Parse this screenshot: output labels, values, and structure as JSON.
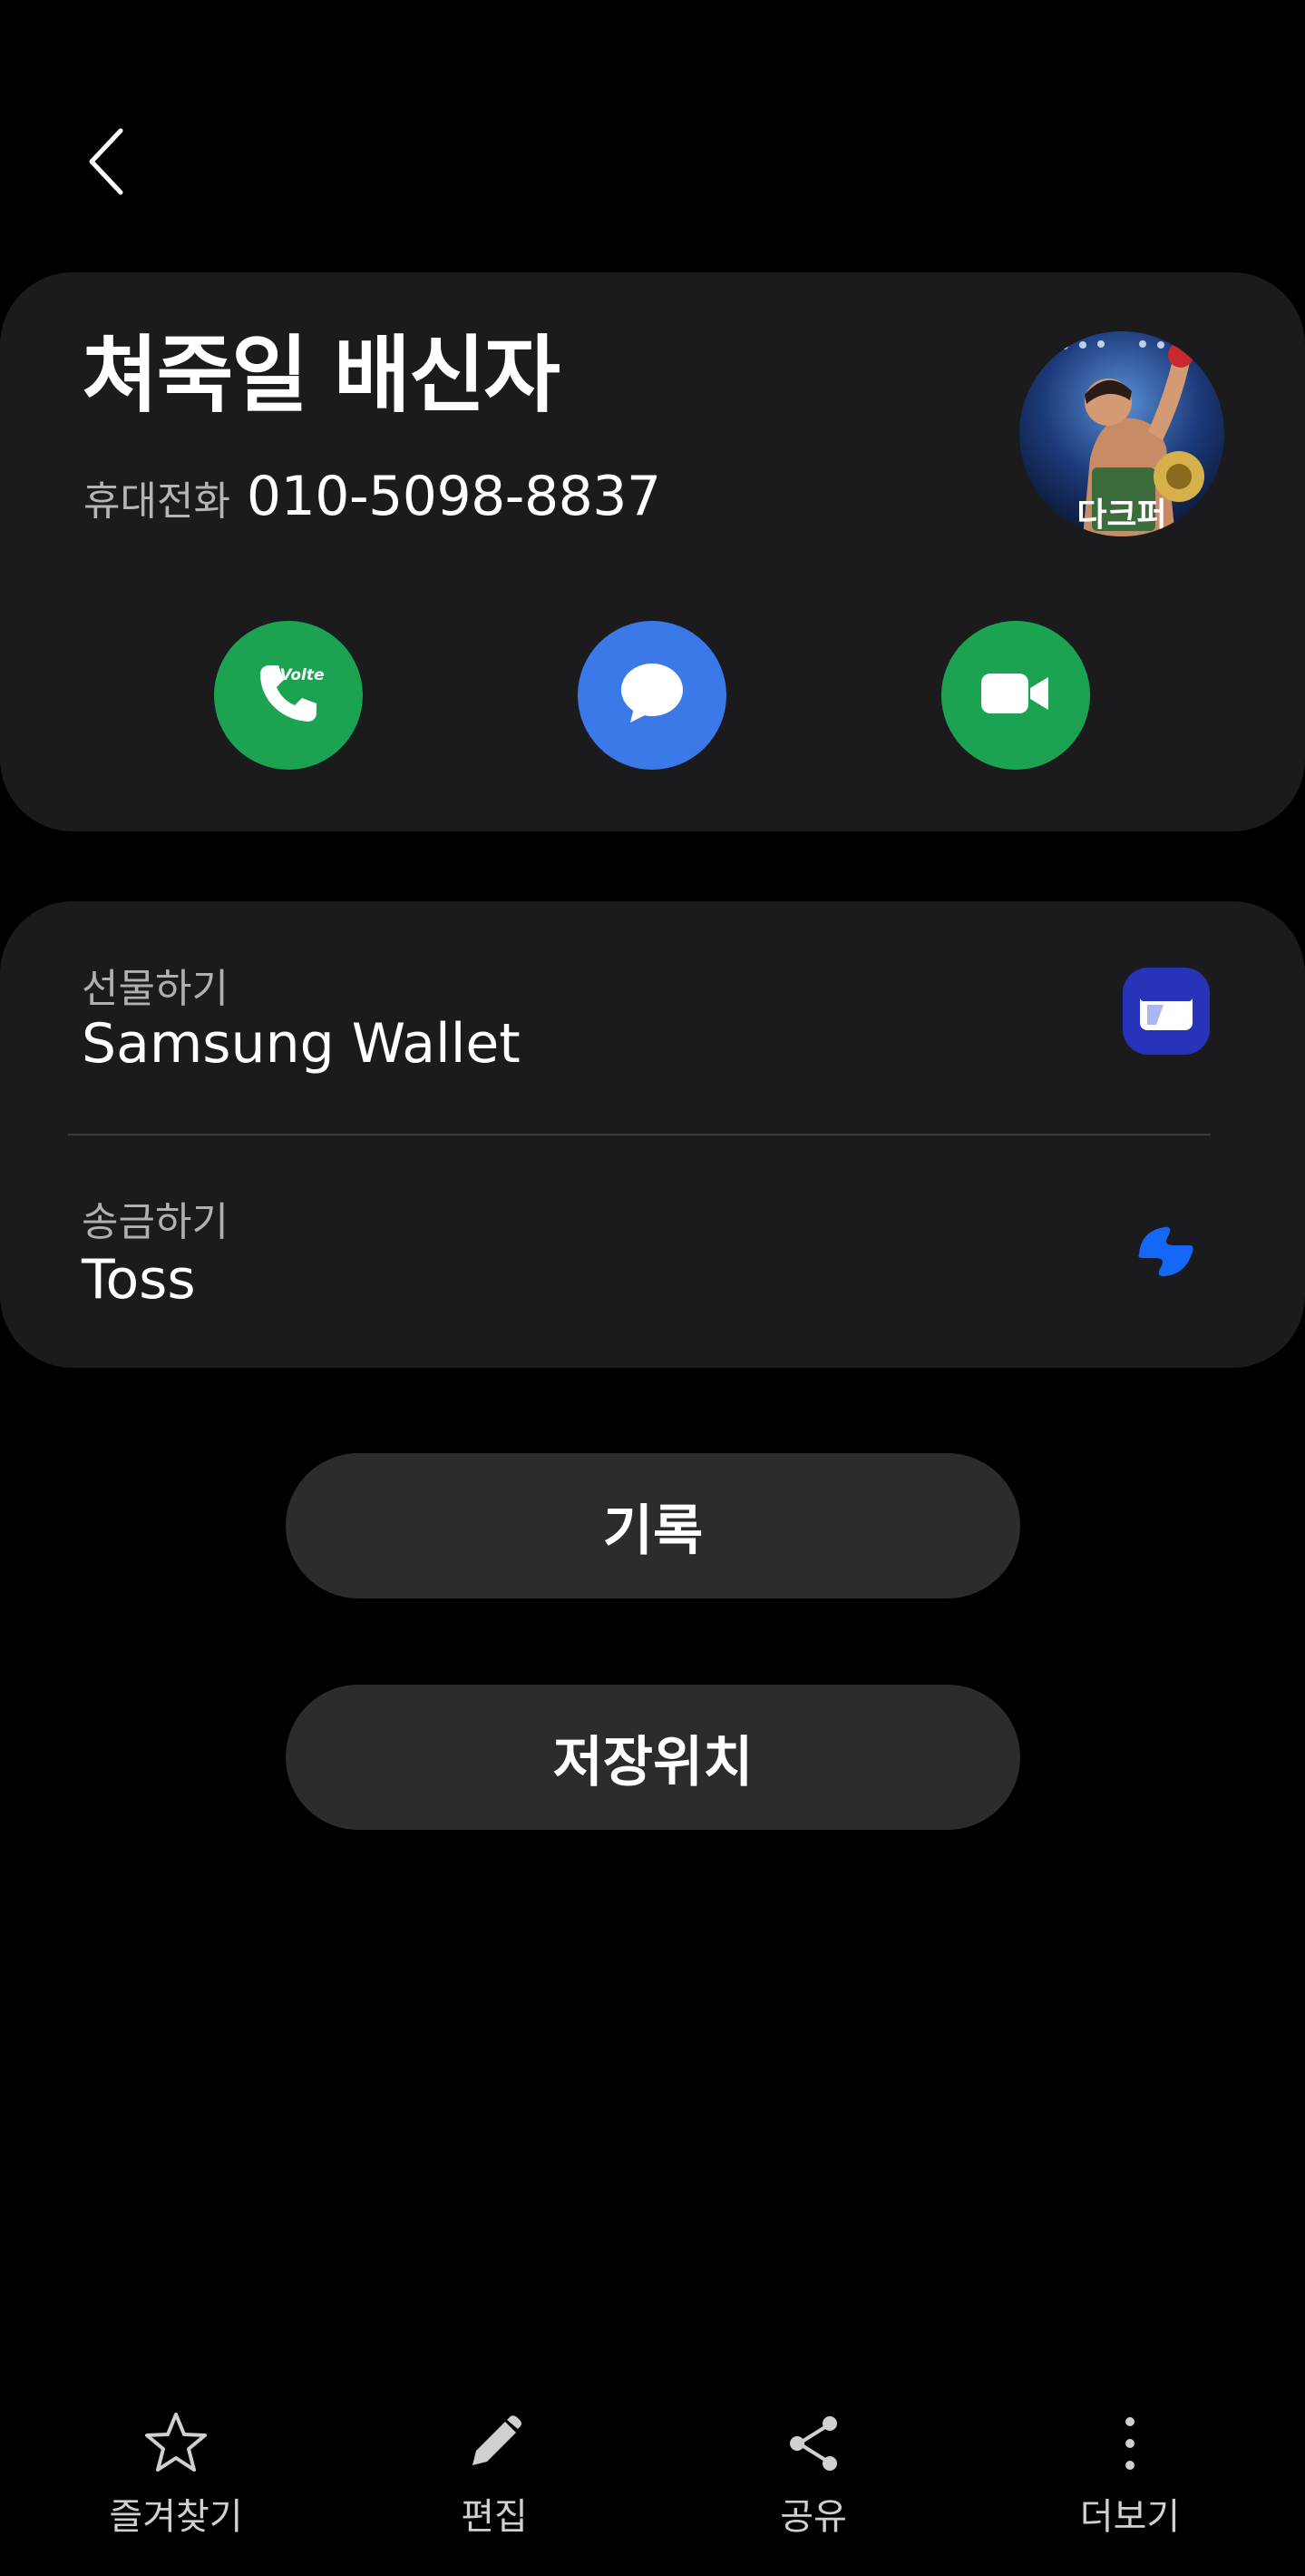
{
  "contact": {
    "name": "쳐죽일 배신자",
    "phone_label": "휴대전화",
    "phone_number": "010-5098-8837",
    "avatar_text": "다크퍼"
  },
  "quick_actions": {
    "call_badge": "Volte",
    "call_icon": "phone-icon",
    "message_icon": "message-bubble-icon",
    "video_icon": "video-camera-icon",
    "call_color": "#1ca352",
    "message_color": "#3b79e8",
    "video_color": "#1ca352"
  },
  "payments": {
    "items": [
      {
        "label": "선물하기",
        "service": "Samsung Wallet",
        "icon": "samsung-wallet-icon",
        "icon_color": "#2733b8"
      },
      {
        "label": "송금하기",
        "service": "Toss",
        "icon": "toss-icon",
        "icon_color": "#1468f5"
      }
    ]
  },
  "buttons": {
    "history": "기록",
    "storage_location": "저장위치"
  },
  "bottom_bar": {
    "items": [
      {
        "label": "즐겨찾기",
        "icon": "star-icon"
      },
      {
        "label": "편집",
        "icon": "pencil-icon"
      },
      {
        "label": "공유",
        "icon": "share-icon"
      },
      {
        "label": "더보기",
        "icon": "more-vertical-icon"
      }
    ]
  }
}
